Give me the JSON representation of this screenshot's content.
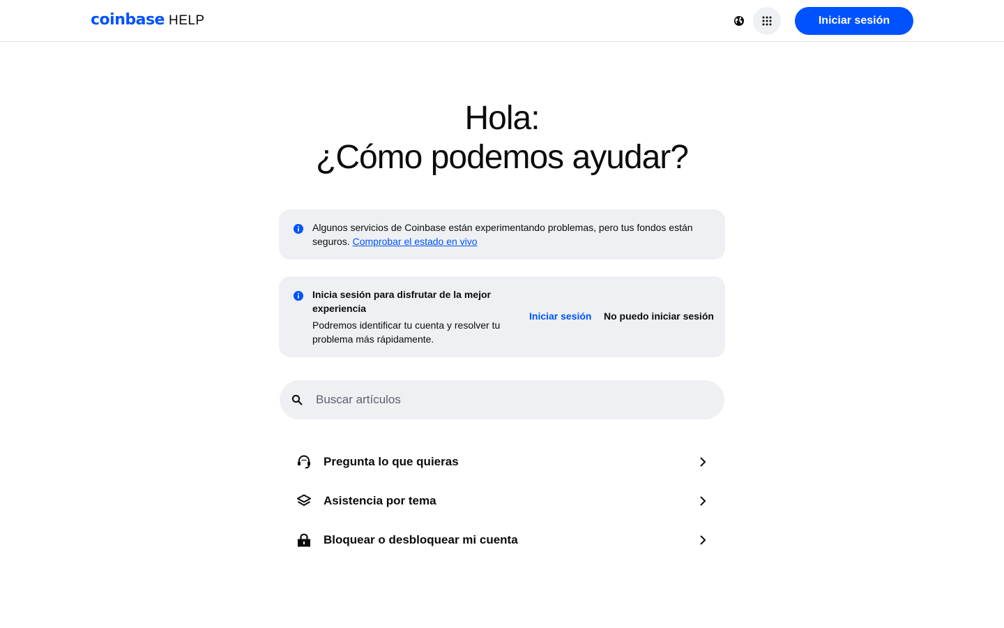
{
  "header": {
    "logo_brand": "coinbase",
    "logo_suffix": "HELP",
    "language_icon": "globe-icon",
    "apps_icon": "grid-icon",
    "signin_label": "Iniciar sesión"
  },
  "hero": {
    "line1": "Hola:",
    "line2": "¿Cómo podemos ayudar?"
  },
  "status_banner": {
    "icon": "info-icon",
    "text": "Algunos servicios de Coinbase están experimentando problemas, pero tus fondos están seguros.",
    "link": "Comprobar el estado en vivo"
  },
  "signin_banner": {
    "icon": "info-icon",
    "title": "Inicia sesión para disfrutar de la mejor experiencia",
    "description": "Podremos identificar tu cuenta y resolver tu problema más rápidamente.",
    "signin_link": "Iniciar sesión",
    "cant_signin_link": "No puedo iniciar sesión"
  },
  "search": {
    "icon": "search-icon",
    "placeholder": "Buscar artículos",
    "value": ""
  },
  "quick_links": [
    {
      "icon": "headset-icon",
      "label": "Pregunta lo que quieras"
    },
    {
      "icon": "layers-icon",
      "label": "Asistencia por tema"
    },
    {
      "icon": "lock-icon",
      "label": "Bloquear o desbloquear mi cuenta"
    }
  ],
  "colors": {
    "brand": "#0052ff",
    "surface": "#eef0f3",
    "text": "#0a0b0d",
    "muted": "#5b616e"
  }
}
